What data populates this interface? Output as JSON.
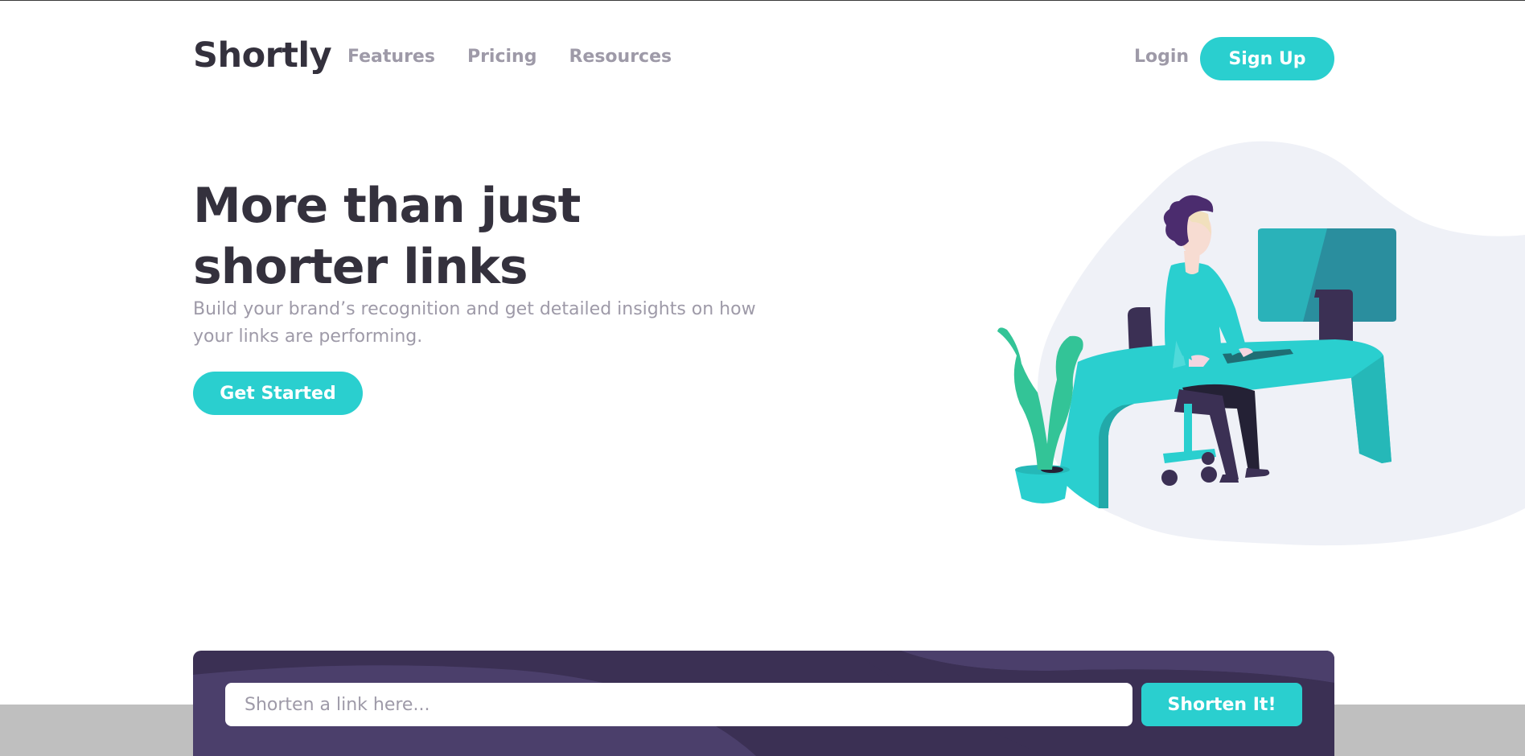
{
  "brand": {
    "name": "Shortly"
  },
  "nav": {
    "items": [
      {
        "label": "Features"
      },
      {
        "label": "Pricing"
      },
      {
        "label": "Resources"
      }
    ],
    "login_label": "Login",
    "signup_label": "Sign Up"
  },
  "hero": {
    "title": "More than just shorter links",
    "subtitle": "Build your brand’s recognition and get detailed insights on how your links are performing.",
    "cta_label": "Get Started",
    "illustration_icon": "person-working-at-desk-illustration"
  },
  "shorten": {
    "placeholder": "Shorten a link here...",
    "value": "",
    "button_label": "Shorten It!"
  },
  "colors": {
    "accent": "#2acfcf",
    "dark_violet": "#3b3054",
    "text_dark": "#34313d",
    "text_gray": "#9e9aa8"
  }
}
